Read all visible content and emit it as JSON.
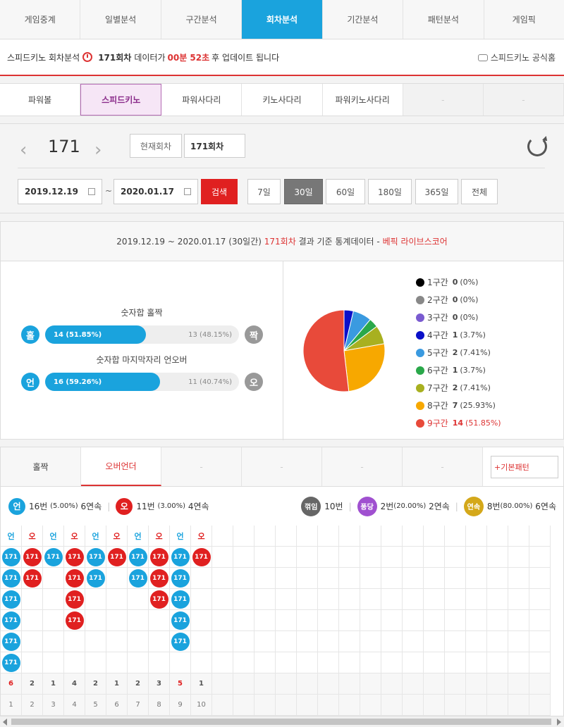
{
  "topnav": [
    {
      "label": "게임중계",
      "active": false
    },
    {
      "label": "일별분석",
      "active": false
    },
    {
      "label": "구간분석",
      "active": false
    },
    {
      "label": "회차분석",
      "active": true
    },
    {
      "label": "기간분석",
      "active": false
    },
    {
      "label": "패턴분석",
      "active": false
    },
    {
      "label": "게임픽",
      "active": false
    }
  ],
  "infobar": {
    "prefix": "스피드키노 회차분석",
    "round": "171회차",
    "mid": "데이터가",
    "countdown": "00분 52초",
    "suffix": "후 업데이트 됩니다",
    "official": "스피드키노 공식홈"
  },
  "gametabs": [
    {
      "label": "파워볼",
      "active": false
    },
    {
      "label": "스피드키노",
      "active": true
    },
    {
      "label": "파워사다리",
      "active": false
    },
    {
      "label": "키노사다리",
      "active": false
    },
    {
      "label": "파워키노사다리",
      "active": false
    },
    {
      "label": "-",
      "active": false
    },
    {
      "label": "-",
      "active": false
    }
  ],
  "selector": {
    "prev": "‹",
    "next": "›",
    "round_number": "171",
    "current_label": "현재회차",
    "current_value": "171회차",
    "date_from": "2019.12.19",
    "tilde": "~",
    "date_to": "2020.01.17",
    "search": "검색",
    "periods": [
      {
        "label": "7일",
        "active": false
      },
      {
        "label": "30일",
        "active": true
      },
      {
        "label": "60일",
        "active": false
      },
      {
        "label": "180일",
        "active": false
      },
      {
        "label": "365일",
        "active": false
      },
      {
        "label": "전체",
        "active": false
      }
    ]
  },
  "stats": {
    "head_range": "2019.12.19 ~ 2020.01.17 (30일간)",
    "head_round": "171회차",
    "head_mid": "결과 기준 통계데이터 -",
    "head_source": "베픽 라이브스코어",
    "bar1": {
      "title": "숫자합 홀짝",
      "left_icon": "홀",
      "left_value": "14 (51.85%)",
      "left_frac": 0.5185,
      "right_value": "13 (48.15%)",
      "right_icon": "짝"
    },
    "bar2": {
      "title": "숫자합 마지막자리 언오버",
      "left_icon": "언",
      "left_value": "16 (59.26%)",
      "left_frac": 0.5926,
      "right_value": "11 (40.74%)",
      "right_icon": "오"
    },
    "legend": [
      {
        "label": "1구간",
        "value": "0",
        "pct": "(0%)",
        "count": 0,
        "color": "#000000"
      },
      {
        "label": "2구간",
        "value": "0",
        "pct": "(0%)",
        "count": 0,
        "color": "#888888"
      },
      {
        "label": "3구간",
        "value": "0",
        "pct": "(0%)",
        "count": 0,
        "color": "#7a5bd0"
      },
      {
        "label": "4구간",
        "value": "1",
        "pct": "(3.7%)",
        "count": 1,
        "color": "#0a10c8"
      },
      {
        "label": "5구간",
        "value": "2",
        "pct": "(7.41%)",
        "count": 2,
        "color": "#3a9ae0"
      },
      {
        "label": "6구간",
        "value": "1",
        "pct": "(3.7%)",
        "count": 1,
        "color": "#2aa84a"
      },
      {
        "label": "7구간",
        "value": "2",
        "pct": "(7.41%)",
        "count": 2,
        "color": "#a8b020"
      },
      {
        "label": "8구간",
        "value": "7",
        "pct": "(25.93%)",
        "count": 7,
        "color": "#f7a800"
      },
      {
        "label": "9구간",
        "value": "14",
        "pct": "(51.85%)",
        "count": 14,
        "color": "#e84a3a"
      }
    ]
  },
  "pattern": {
    "tabs": [
      {
        "label": "홀짝",
        "active": false
      },
      {
        "label": "오버언더",
        "active": true
      },
      {
        "label": "-",
        "active": false
      },
      {
        "label": "-",
        "active": false
      },
      {
        "label": "-",
        "active": false
      },
      {
        "label": "-",
        "active": false
      }
    ],
    "basic_button": "+기본패턴",
    "summary": {
      "under_icon": "언",
      "under_count": "16번",
      "under_pct": "(5.00%)",
      "under_streak": "6연속",
      "over_icon": "오",
      "over_count": "11번",
      "over_pct": "(3.00%)",
      "over_streak": "4연속",
      "break_icon": "꺾임",
      "break_count": "10번",
      "pong_icon": "퐁당",
      "pong_count": "2번",
      "pong_pct": "(20.00%)",
      "pong_streak": "2연속",
      "cont_icon": "연속",
      "cont_count": "8번",
      "cont_pct": "(80.00%)",
      "cont_streak": "6연속"
    },
    "headers": [
      "언",
      "오",
      "언",
      "오",
      "언",
      "오",
      "언",
      "오",
      "언",
      "오"
    ],
    "ball_label": "171",
    "columns": [
      {
        "type": "u",
        "count": 6
      },
      {
        "type": "o",
        "count": 2
      },
      {
        "type": "u",
        "count": 1
      },
      {
        "type": "o",
        "count": 4
      },
      {
        "type": "u",
        "count": 2
      },
      {
        "type": "o",
        "count": 1
      },
      {
        "type": "u",
        "count": 2
      },
      {
        "type": "o",
        "count": 3
      },
      {
        "type": "u",
        "count": 5
      },
      {
        "type": "o",
        "count": 1
      }
    ],
    "counts": [
      "6",
      "2",
      "1",
      "4",
      "2",
      "1",
      "2",
      "3",
      "5",
      "1"
    ],
    "indexes": [
      "1",
      "2",
      "3",
      "4",
      "5",
      "6",
      "7",
      "8",
      "9",
      "10"
    ]
  }
}
